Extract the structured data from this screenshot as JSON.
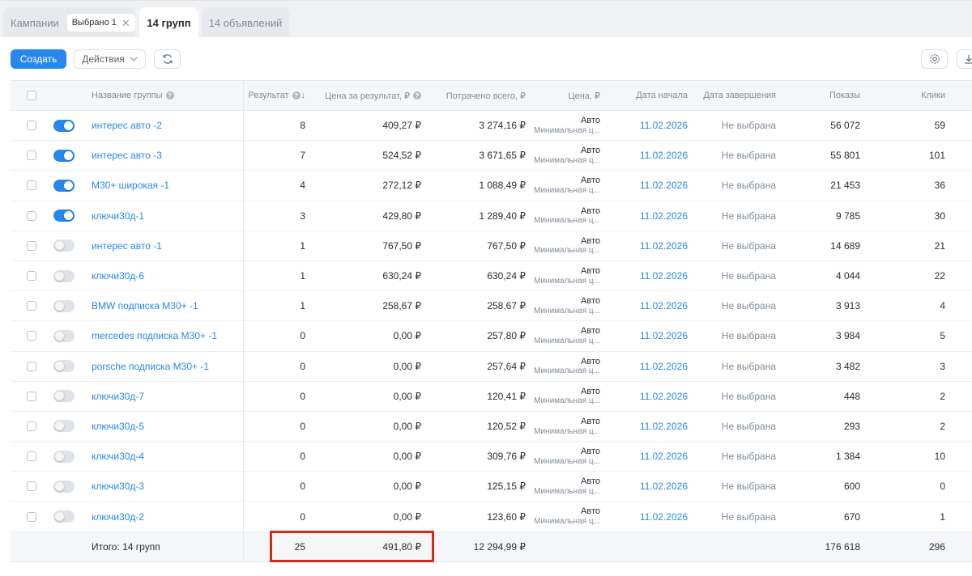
{
  "tabs": {
    "campaigns": {
      "label": "Кампании",
      "chip": "Выбрано 1"
    },
    "groups": {
      "label": "14 групп"
    },
    "ads": {
      "label": "14 объявлений"
    }
  },
  "toolbar": {
    "create_label": "Создать",
    "actions_label": "Действия"
  },
  "table": {
    "headers": {
      "name": "Название группы",
      "result": "Результат",
      "price": "Цена за результат, ₽",
      "spent": "Потрачено всего, ₽",
      "cpa": "Цена, ₽",
      "start": "Дата начала",
      "end": "Дата завершения",
      "impressions": "Показы",
      "clicks": "Клики"
    },
    "rows": [
      {
        "on": true,
        "name": "интерес авто -2",
        "result": "8",
        "price": "409,27 ₽",
        "spent": "3 274,16 ₽",
        "cpa_top": "Авто",
        "cpa_sub": "Минимальная ц...",
        "start": "11.02.2026",
        "end": "Не выбрана",
        "impressions": "56 072",
        "clicks": "59"
      },
      {
        "on": true,
        "name": "интерес авто -3",
        "result": "7",
        "price": "524,52 ₽",
        "spent": "3 671,65 ₽",
        "cpa_top": "Авто",
        "cpa_sub": "Минимальная ц...",
        "start": "11.02.2026",
        "end": "Не выбрана",
        "impressions": "55 801",
        "clicks": "101"
      },
      {
        "on": true,
        "name": "М30+ широкая -1",
        "result": "4",
        "price": "272,12 ₽",
        "spent": "1 088,49 ₽",
        "cpa_top": "Авто",
        "cpa_sub": "Минимальная ц...",
        "start": "11.02.2026",
        "end": "Не выбрана",
        "impressions": "21 453",
        "clicks": "36"
      },
      {
        "on": true,
        "name": "ключи30д-1",
        "result": "3",
        "price": "429,80 ₽",
        "spent": "1 289,40 ₽",
        "cpa_top": "Авто",
        "cpa_sub": "Минимальная ц...",
        "start": "11.02.2026",
        "end": "Не выбрана",
        "impressions": "9 785",
        "clicks": "30"
      },
      {
        "on": false,
        "name": "интерес авто -1",
        "result": "1",
        "price": "767,50 ₽",
        "spent": "767,50 ₽",
        "cpa_top": "Авто",
        "cpa_sub": "Минимальная ц...",
        "start": "11.02.2026",
        "end": "Не выбрана",
        "impressions": "14 689",
        "clicks": "21"
      },
      {
        "on": false,
        "name": "ключи30д-6",
        "result": "1",
        "price": "630,24 ₽",
        "spent": "630,24 ₽",
        "cpa_top": "Авто",
        "cpa_sub": "Минимальная ц...",
        "start": "11.02.2026",
        "end": "Не выбрана",
        "impressions": "4 044",
        "clicks": "22"
      },
      {
        "on": false,
        "name": "BMW подписка М30+ -1",
        "result": "1",
        "price": "258,67 ₽",
        "spent": "258,67 ₽",
        "cpa_top": "Авто",
        "cpa_sub": "Минимальная ц...",
        "start": "11.02.2026",
        "end": "Не выбрана",
        "impressions": "3 913",
        "clicks": "4"
      },
      {
        "on": false,
        "name": "mercedes подписка М30+ -1",
        "result": "0",
        "price": "0,00 ₽",
        "spent": "257,80 ₽",
        "cpa_top": "Авто",
        "cpa_sub": "Минимальная ц...",
        "start": "11.02.2026",
        "end": "Не выбрана",
        "impressions": "3 984",
        "clicks": "5"
      },
      {
        "on": false,
        "name": "porsche подписка М30+ -1",
        "result": "0",
        "price": "0,00 ₽",
        "spent": "257,64 ₽",
        "cpa_top": "Авто",
        "cpa_sub": "Минимальная ц...",
        "start": "11.02.2026",
        "end": "Не выбрана",
        "impressions": "3 482",
        "clicks": "3"
      },
      {
        "on": false,
        "name": "ключи30д-7",
        "result": "0",
        "price": "0,00 ₽",
        "spent": "120,41 ₽",
        "cpa_top": "Авто",
        "cpa_sub": "Минимальная ц...",
        "start": "11.02.2026",
        "end": "Не выбрана",
        "impressions": "448",
        "clicks": "2"
      },
      {
        "on": false,
        "name": "ключи30д-5",
        "result": "0",
        "price": "0,00 ₽",
        "spent": "120,52 ₽",
        "cpa_top": "Авто",
        "cpa_sub": "Минимальная ц...",
        "start": "11.02.2026",
        "end": "Не выбрана",
        "impressions": "293",
        "clicks": "2"
      },
      {
        "on": false,
        "name": "ключи30д-4",
        "result": "0",
        "price": "0,00 ₽",
        "spent": "309,76 ₽",
        "cpa_top": "Авто",
        "cpa_sub": "Минимальная ц...",
        "start": "11.02.2026",
        "end": "Не выбрана",
        "impressions": "1 384",
        "clicks": "10"
      },
      {
        "on": false,
        "name": "ключи30д-3",
        "result": "0",
        "price": "0,00 ₽",
        "spent": "125,15 ₽",
        "cpa_top": "Авто",
        "cpa_sub": "Минимальная ц...",
        "start": "11.02.2026",
        "end": "Не выбрана",
        "impressions": "600",
        "clicks": "0"
      },
      {
        "on": false,
        "name": "ключи30д-2",
        "result": "0",
        "price": "0,00 ₽",
        "spent": "123,60 ₽",
        "cpa_top": "Авто",
        "cpa_sub": "Минимальная ц...",
        "start": "11.02.2026",
        "end": "Не выбрана",
        "impressions": "670",
        "clicks": "1"
      }
    ],
    "totals": {
      "label": "Итого: 14 групп",
      "result": "25",
      "price": "491,80 ₽",
      "spent": "12 294,99 ₽",
      "impressions": "176 618",
      "clicks": "296"
    }
  },
  "colors": {
    "accent": "#2688eb",
    "highlight": "#d8281a"
  }
}
